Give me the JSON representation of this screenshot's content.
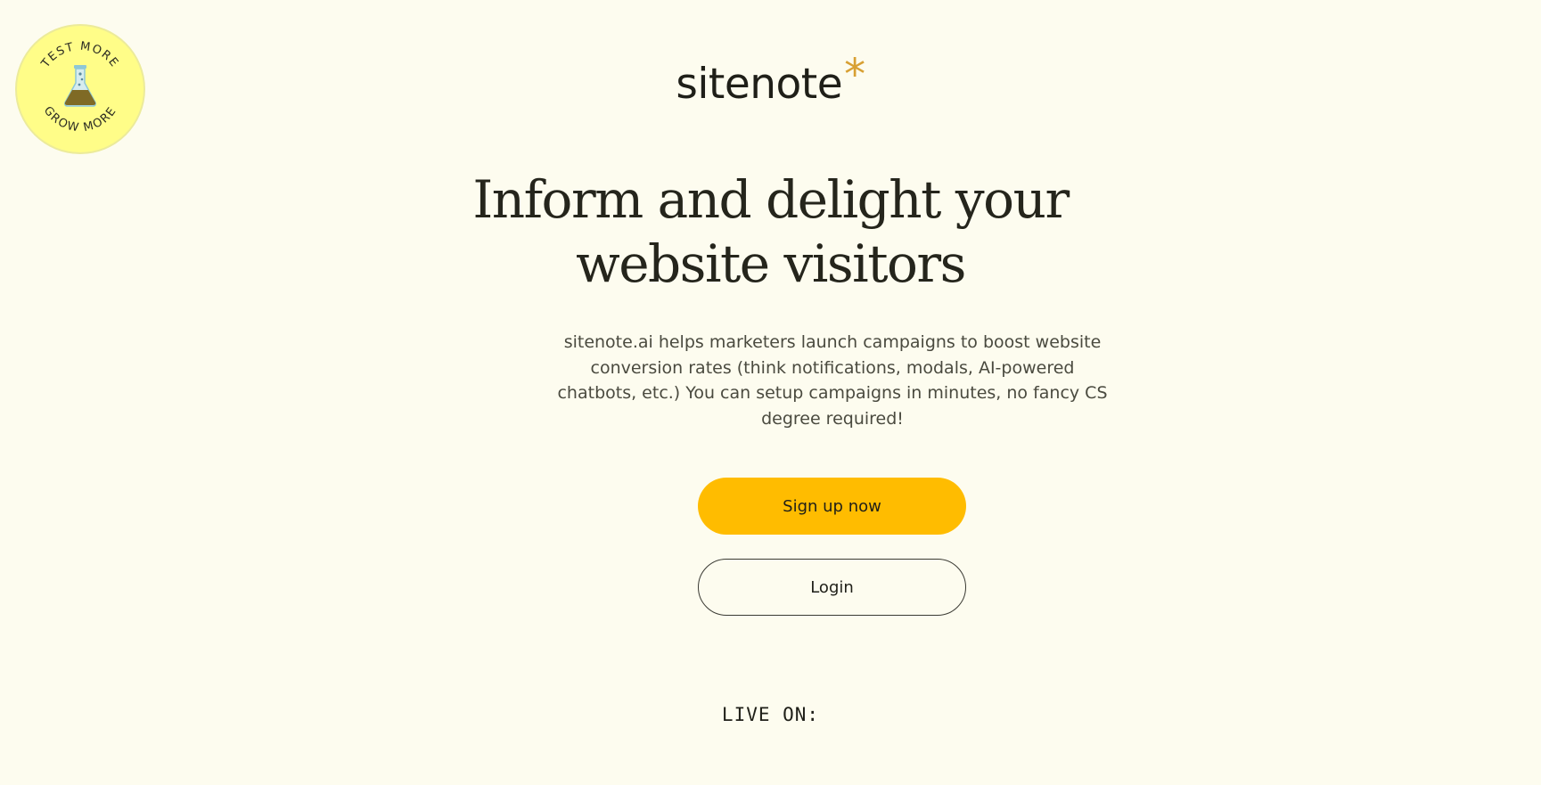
{
  "badge": {
    "top_text": "TEST MORE",
    "bottom_text": "GROW MORE",
    "icon": "flask-icon",
    "background_color": "#fffd88"
  },
  "header": {
    "logo_text": "sitenote",
    "logo_star": "*",
    "star_color": "#d8a033"
  },
  "hero": {
    "headline": "Inform and delight your website visitors",
    "subtext": "sitenote.ai helps marketers launch campaigns to boost website conversion rates (think notifications, modals, AI-powered chatbots, etc.) You can setup campaigns in minutes, no fancy CS degree required!"
  },
  "actions": {
    "signup_label": "Sign up now",
    "login_label": "Login",
    "accent_color": "#ffbc00"
  },
  "footer": {
    "live_on_label": "LIVE ON:"
  },
  "colors": {
    "background": "#fdfcef",
    "text": "#1f1f18"
  }
}
